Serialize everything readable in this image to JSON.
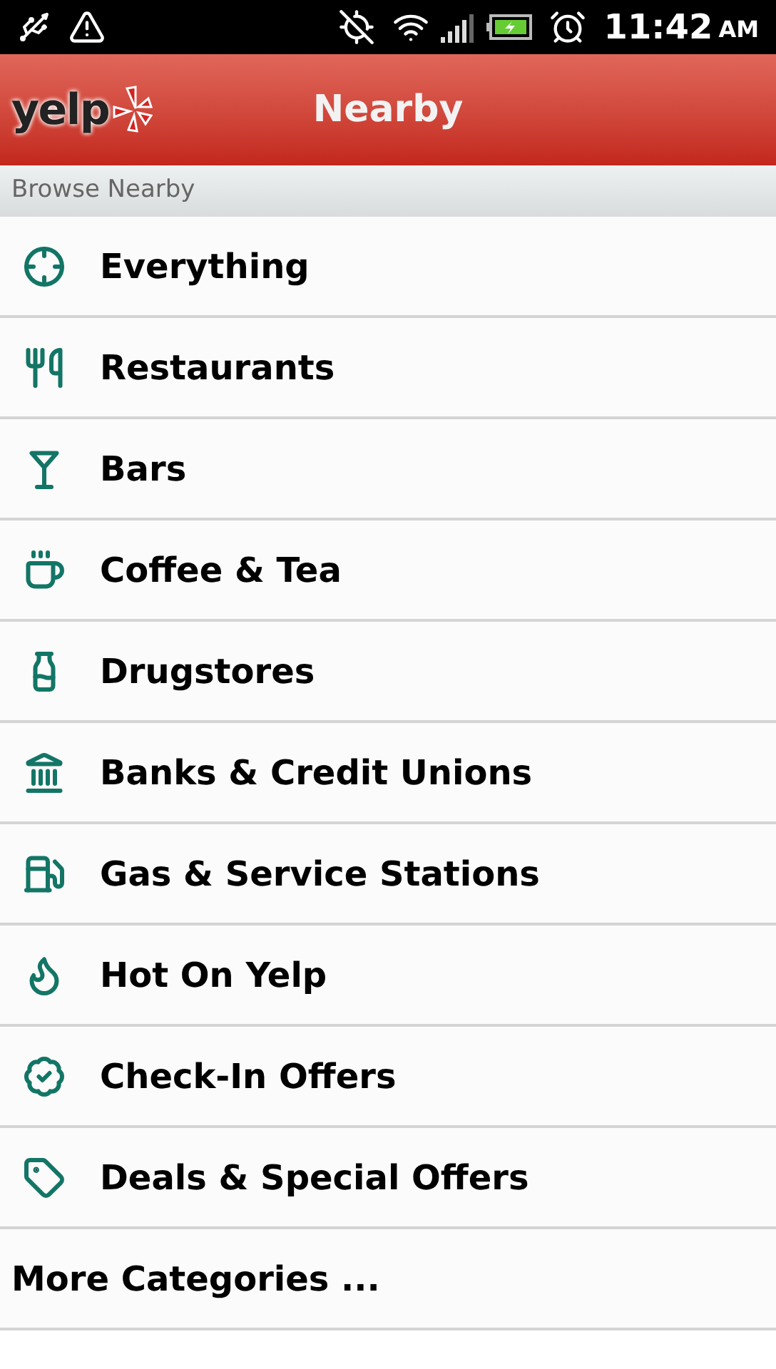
{
  "status_bar": {
    "time": "11:42",
    "meridiem": "AM"
  },
  "header": {
    "logo": "yelp",
    "title": "Nearby"
  },
  "section": {
    "title": "Browse Nearby"
  },
  "items": [
    {
      "kind": "category",
      "label": "Everything"
    },
    {
      "kind": "category",
      "label": "Restaurants"
    },
    {
      "kind": "category",
      "label": "Bars"
    },
    {
      "kind": "category",
      "label": "Coffee & Tea"
    },
    {
      "kind": "category",
      "label": "Drugstores"
    },
    {
      "kind": "category",
      "label": "Banks & Credit Unions"
    },
    {
      "kind": "category",
      "label": "Gas & Service Stations"
    },
    {
      "kind": "category",
      "label": "Hot On Yelp"
    },
    {
      "kind": "category",
      "label": "Check-In Offers"
    },
    {
      "kind": "category",
      "label": "Deals & Special Offers"
    },
    {
      "kind": "more",
      "label": "More Categories ..."
    }
  ]
}
